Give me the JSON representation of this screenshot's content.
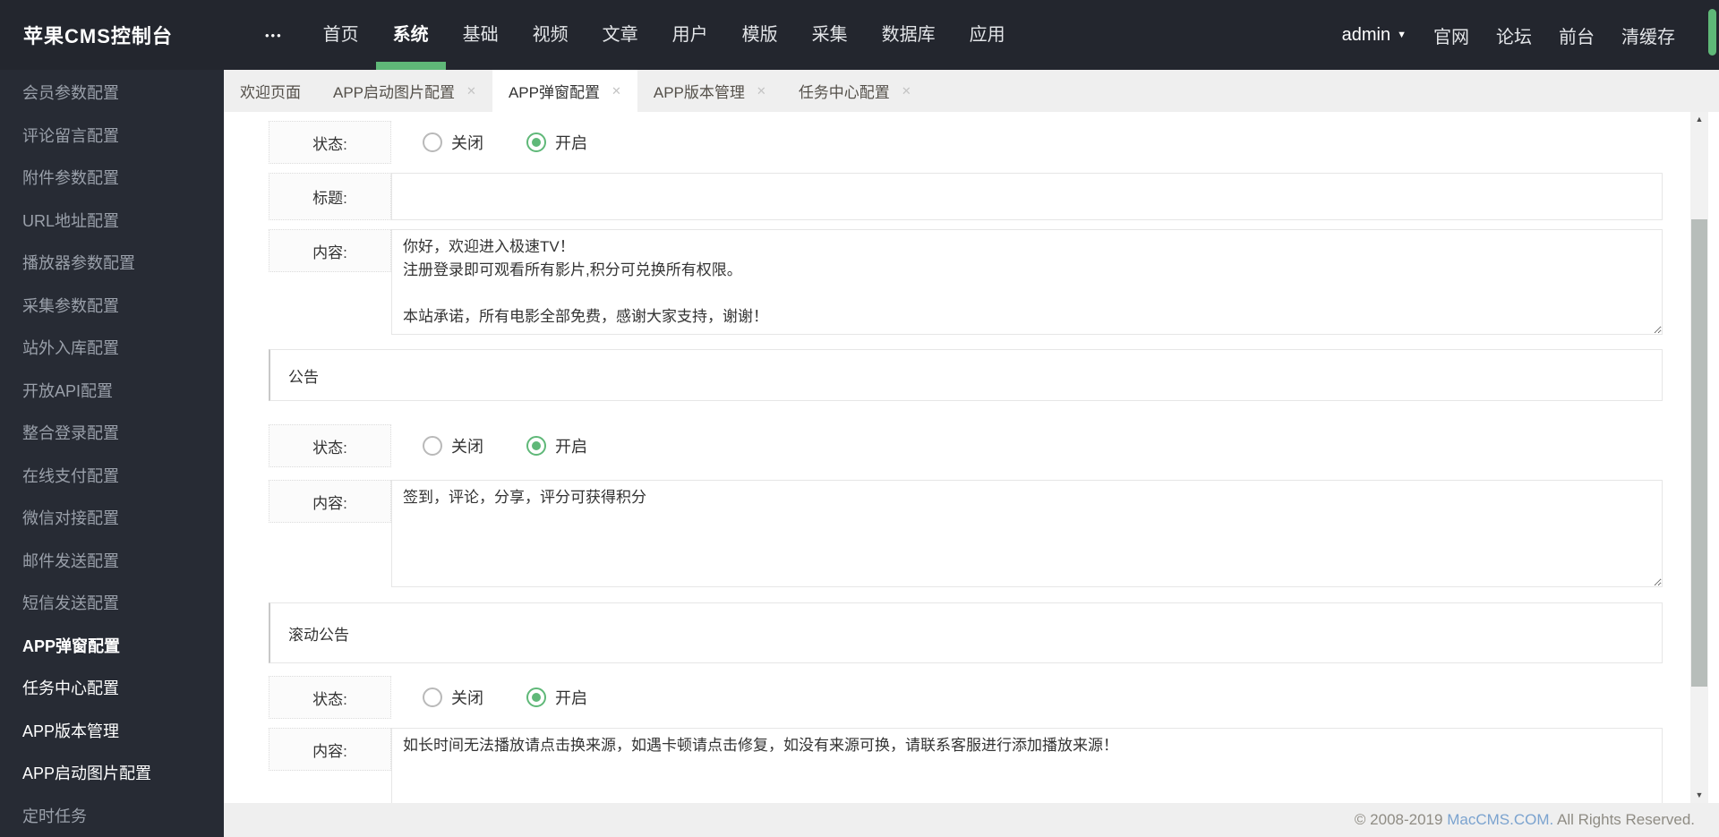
{
  "topbar": {
    "logo": "苹果CMS控制台",
    "menu": [
      "首页",
      "系统",
      "基础",
      "视频",
      "文章",
      "用户",
      "模版",
      "采集",
      "数据库",
      "应用"
    ],
    "active_menu": "系统",
    "user": "admin",
    "links": [
      "官网",
      "论坛",
      "前台",
      "清缓存"
    ]
  },
  "sidebar": {
    "items": [
      "会员参数配置",
      "评论留言配置",
      "附件参数配置",
      "URL地址配置",
      "播放器参数配置",
      "采集参数配置",
      "站外入库配置",
      "开放API配置",
      "整合登录配置",
      "在线支付配置",
      "微信对接配置",
      "邮件发送配置",
      "短信发送配置",
      "APP弹窗配置",
      "任务中心配置",
      "APP版本管理",
      "APP启动图片配置",
      "定时任务"
    ],
    "active_item": "APP弹窗配置",
    "open_items": [
      "任务中心配置",
      "APP版本管理",
      "APP启动图片配置"
    ]
  },
  "tabs": {
    "list": [
      {
        "label": "欢迎页面",
        "closable": false,
        "active": false
      },
      {
        "label": "APP启动图片配置",
        "closable": true,
        "active": false
      },
      {
        "label": "APP弹窗配置",
        "closable": true,
        "active": true
      },
      {
        "label": "APP版本管理",
        "closable": true,
        "active": false
      },
      {
        "label": "任务中心配置",
        "closable": true,
        "active": false
      }
    ]
  },
  "form": {
    "status_label": "状态:",
    "title_label": "标题:",
    "content_label": "内容:",
    "radio": {
      "off": "关闭",
      "on": "开启"
    },
    "popup": {
      "status": "开启",
      "title_value": "",
      "content": "你好，欢迎进入极速TV！\n注册登录即可观看所有影片,积分可兑换所有权限。\n\n本站承诺，所有电影全部免费，感谢大家支持，谢谢！"
    },
    "notice": {
      "header": "公告",
      "status": "开启",
      "content": "签到，评论，分享，评分可获得积分"
    },
    "scroll_notice": {
      "header": "滚动公告",
      "status": "开启",
      "content": "如长时间无法播放请点击换来源，如遇卡顿请点击修复，如没有来源可换，请联系客服进行添加播放来源！"
    }
  },
  "footer": {
    "prefix": "© 2008-2019 ",
    "link": "MacCMS.COM.",
    "suffix": " All Rights Reserved."
  },
  "icons": {
    "more": "•••",
    "caret_down": "▼",
    "tab_close": "✕",
    "scroll_up": "▲",
    "scroll_down": "▼"
  },
  "colors": {
    "accent_green": "#5FB878",
    "header_bg": "#23262e",
    "sidebar_bg": "#272b34",
    "link_blue": "#7ba3cf"
  }
}
